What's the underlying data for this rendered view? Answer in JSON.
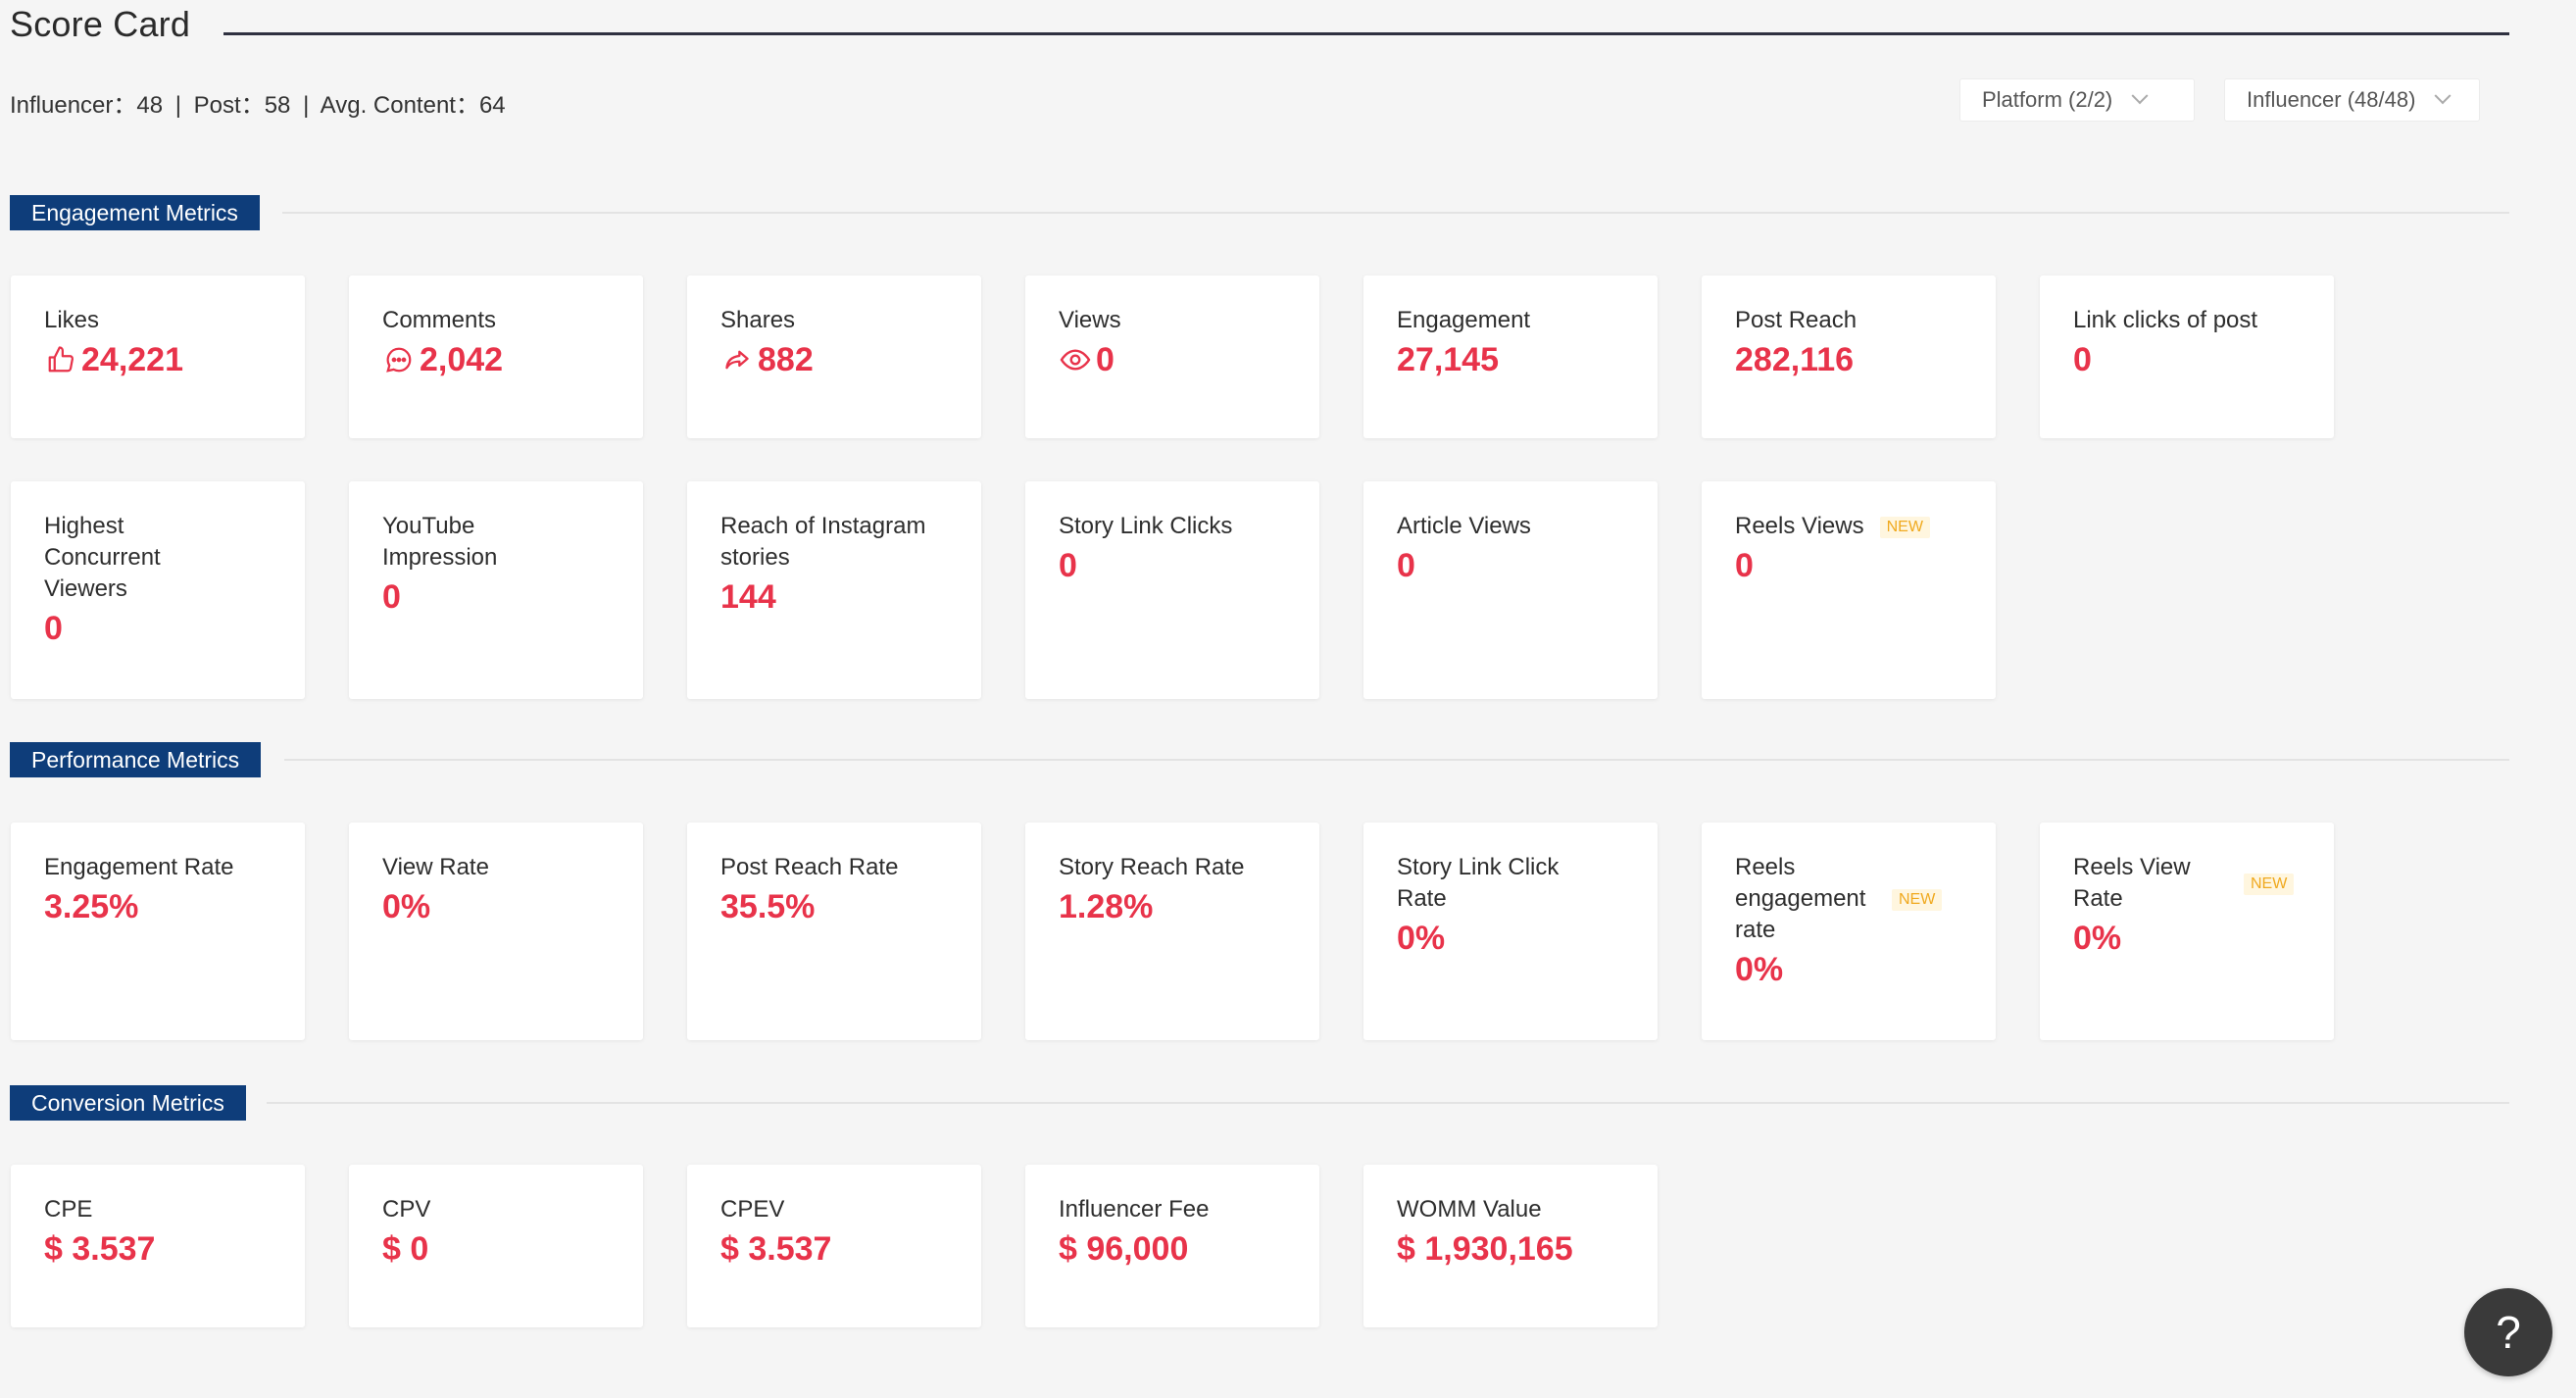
{
  "header": {
    "title": "Score Card",
    "summary": {
      "influencer_label": "Influencer：48",
      "post_label": "Post：58",
      "avg_content_label": "Avg. Content：64",
      "separator": "|"
    },
    "platform_dropdown": "Platform (2/2)",
    "influencer_dropdown": "Influencer (48/48)"
  },
  "sections": {
    "engagement": {
      "title": "Engagement Metrics",
      "cards": [
        {
          "label": "Likes",
          "value": "24,221",
          "icon": "thumbs-up-icon"
        },
        {
          "label": "Comments",
          "value": "2,042",
          "icon": "comment-icon"
        },
        {
          "label": "Shares",
          "value": "882",
          "icon": "share-icon"
        },
        {
          "label": "Views",
          "value": "0",
          "icon": "eye-icon"
        },
        {
          "label": "Engagement",
          "value": "27,145"
        },
        {
          "label": "Post Reach",
          "value": "282,116"
        },
        {
          "label": "Link clicks of post",
          "value": "0"
        },
        {
          "label": "Highest Concurrent Viewers",
          "value": "0"
        },
        {
          "label": "YouTube Impression",
          "value": "0"
        },
        {
          "label": "Reach of Instagram stories",
          "value": "144"
        },
        {
          "label": "Story Link Clicks",
          "value": "0"
        },
        {
          "label": "Article Views",
          "value": "0"
        },
        {
          "label": "Reels Views",
          "value": "0",
          "badge": "NEW"
        }
      ]
    },
    "performance": {
      "title": "Performance Metrics",
      "cards": [
        {
          "label": "Engagement Rate",
          "value": "3.25%"
        },
        {
          "label": "View Rate",
          "value": "0%"
        },
        {
          "label": "Post Reach Rate",
          "value": "35.5%"
        },
        {
          "label": "Story Reach Rate",
          "value": "1.28%"
        },
        {
          "label": "Story Link Click Rate",
          "value": "0%"
        },
        {
          "label": "Reels engagement rate",
          "value": "0%",
          "badge": "NEW"
        },
        {
          "label": "Reels View Rate",
          "value": "0%",
          "badge": "NEW"
        }
      ]
    },
    "conversion": {
      "title": "Conversion Metrics",
      "cards": [
        {
          "label": "CPE",
          "value": "$ 3.537"
        },
        {
          "label": "CPV",
          "value": "$ 0"
        },
        {
          "label": "CPEV",
          "value": "$ 3.537"
        },
        {
          "label": "Influencer Fee",
          "value": "$ 96,000"
        },
        {
          "label": "WOMM Value",
          "value": "$ 1,930,165"
        }
      ]
    }
  },
  "help_button": "?",
  "colors": {
    "accent_value": "#e8334a",
    "section_label_bg": "#0e3d7a",
    "badge_text": "#f0a91e",
    "badge_bg": "#fff6df"
  }
}
